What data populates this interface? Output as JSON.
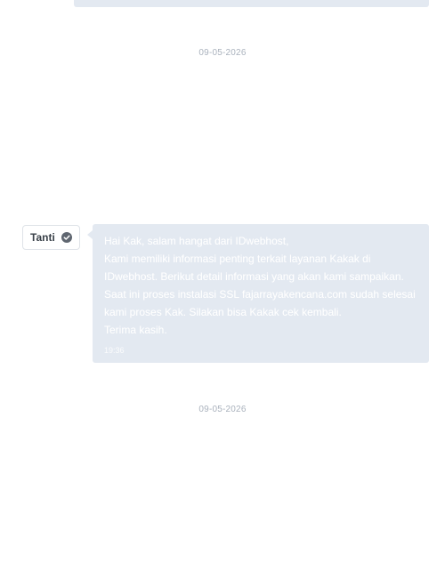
{
  "dates": {
    "first": "09-05-2026",
    "second": "09-05-2026"
  },
  "message": {
    "sender": "Tanti",
    "sender_badge_icon": "verified-check-icon",
    "lines": [
      "Hai Kak, salam hangat dari IDwebhost,",
      "Kami memiliki informasi penting terkait layanan Kakak di",
      "IDwebhost. Berikut detail informasi yang akan kami sampaikan.",
      "Saat ini proses instalasi SSL fajarrayakencana.com sudah selesai",
      "kami proses Kak. Silakan bisa Kakak cek kembali.",
      "Terima kasih."
    ],
    "time": "19:36"
  },
  "colors": {
    "bubble_bg": "#e3e9f1",
    "date_text": "#aab2bd",
    "badge_icon": "#5f6670"
  }
}
